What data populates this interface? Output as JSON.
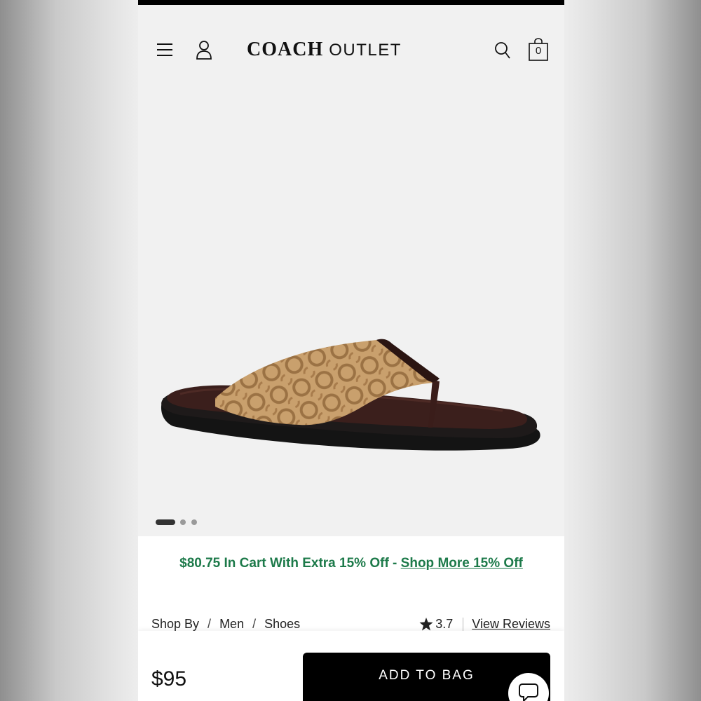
{
  "header": {
    "brand_primary": "COACH",
    "brand_secondary": "OUTLET",
    "bag_count": "0",
    "icons": [
      "menu-icon",
      "account-icon",
      "search-icon",
      "shopping-bag-icon"
    ]
  },
  "product": {
    "image_description_icon": "sandal-image",
    "carousel": {
      "total": 3,
      "active": 1
    }
  },
  "promo": {
    "text": "$80.75 In Cart With Extra 15% Off - ",
    "link": "Shop More 15% Off",
    "color": "#1d7a4a"
  },
  "breadcrumb": {
    "items": [
      "Shop By",
      "Men",
      "Shoes"
    ],
    "separator": "/"
  },
  "rating": {
    "value": "3.7",
    "reviews_link": "View Reviews"
  },
  "purchase": {
    "price": "$95",
    "add_to_bag_label": "ADD TO BAG"
  },
  "colors": {
    "accent": "#000000",
    "promo_green": "#1d7a4a",
    "background": "#f1f1f1"
  }
}
